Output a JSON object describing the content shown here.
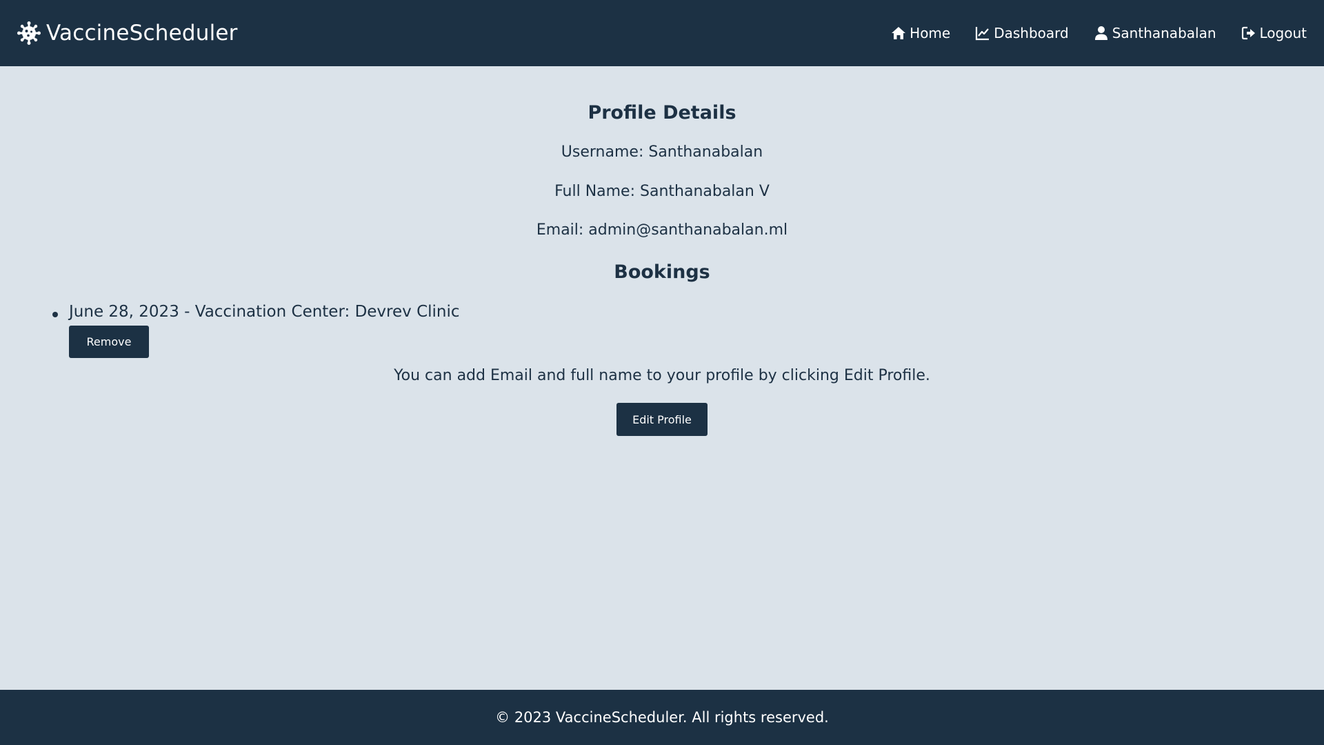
{
  "navbar": {
    "brand": "VaccineScheduler",
    "brand_icon": "virus-icon",
    "links": [
      {
        "label": "Home",
        "icon": "home-icon"
      },
      {
        "label": "Dashboard",
        "icon": "chart-line-icon"
      },
      {
        "label": "Santhanabalan",
        "icon": "user-icon"
      },
      {
        "label": "Logout",
        "icon": "sign-out-icon"
      }
    ]
  },
  "profile": {
    "heading": "Profile Details",
    "username": "Username: Santhanabalan",
    "full_name": "Full Name: Santhanabalan V",
    "email": "Email: admin@santhanabalan.ml"
  },
  "bookings": {
    "heading": "Bookings",
    "items": [
      {
        "text": "June 28, 2023 - Vaccination Center: Devrev Clinic",
        "remove_label": "Remove"
      }
    ]
  },
  "hint": "You can add Email and full name to your profile by clicking Edit Profile.",
  "edit_button_label": "Edit Profile",
  "footer": {
    "text": "© 2023 VaccineScheduler. All rights reserved."
  },
  "colors": {
    "navbar_bg": "#1c3144",
    "page_bg": "#dbe3ea",
    "text": "#1d3144",
    "button_bg": "#1c3144"
  }
}
